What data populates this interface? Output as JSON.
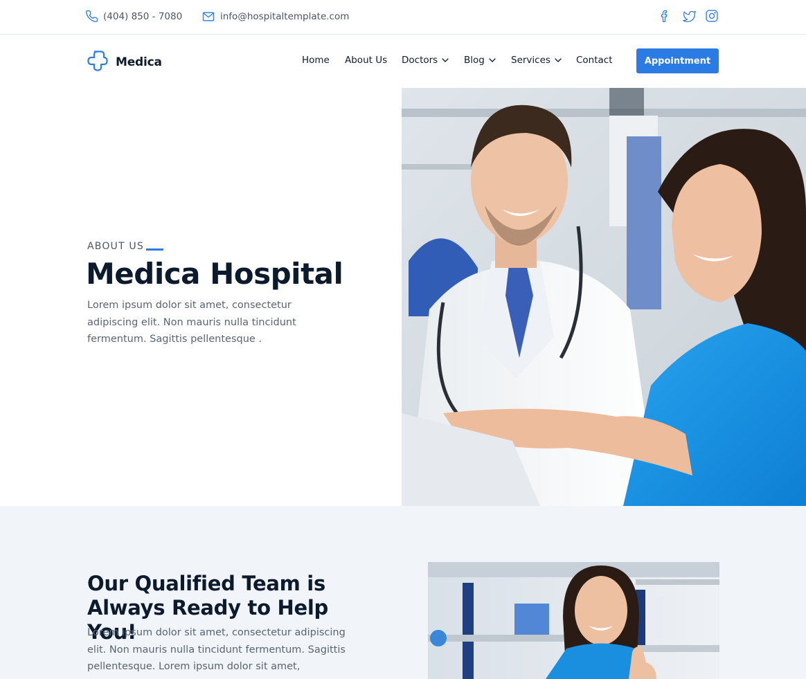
{
  "topbar": {
    "phone": "(404) 850 - 7080",
    "email": "info@hospitaltemplate.com",
    "social": [
      "facebook-icon",
      "twitter-icon",
      "instagram-icon"
    ]
  },
  "brand": {
    "name": "Medica"
  },
  "nav": {
    "items": [
      {
        "label": "Home",
        "dropdown": false
      },
      {
        "label": "About Us",
        "dropdown": false
      },
      {
        "label": "Doctors",
        "dropdown": true
      },
      {
        "label": "Blog",
        "dropdown": true
      },
      {
        "label": "Services",
        "dropdown": true
      },
      {
        "label": "Contact",
        "dropdown": false
      }
    ],
    "cta_label": "Appointment"
  },
  "hero": {
    "eyebrow": "ABOUT US",
    "title": "Medica Hospital",
    "text": "Lorem ipsum dolor sit amet, consectetur adipiscing elit. Non mauris nulla tincidunt fermentum. Sagittis pellentesque ."
  },
  "team": {
    "title": "Our Qualified Team is Always Ready to Help You!",
    "text": "Lorem ipsum dolor sit amet, consectetur adipiscing elit. Non mauris nulla tincidunt fermentum. Sagittis pellentesque. Lorem ipsum dolor sit amet,"
  },
  "colors": {
    "accent": "#2a7be4",
    "heading": "#0c1a2e",
    "body_text": "#5a6472",
    "section_bg": "#f1f5f9"
  }
}
